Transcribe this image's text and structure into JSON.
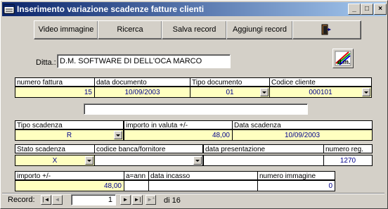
{
  "window": {
    "title": "Inserimento variazione scadenze fatture clienti",
    "minimize": "_",
    "maximize": "□",
    "close": "×"
  },
  "toolbar": {
    "video_label": "Video immagine",
    "search_label": "Ricerca",
    "save_label": "Salva record",
    "add_label": "Aggiungi record",
    "exit_icon": "door-exit-icon"
  },
  "ditta": {
    "label": "Ditta.:",
    "value": "D.M. SOFTWARE DI DELL'OCA MARCO"
  },
  "logo": {
    "text": "d.m."
  },
  "fields": {
    "numero_fattura": {
      "label": "numero fattura",
      "value": "15"
    },
    "data_documento": {
      "label": "data documento",
      "value": "10/09/2003"
    },
    "tipo_documento": {
      "label": "Tipo documento",
      "value": "01"
    },
    "codice_cliente": {
      "label": "Codice cliente",
      "value": "000101"
    },
    "tipo_scadenza": {
      "label": "Tipo scadenza",
      "value": "R"
    },
    "importo_valuta": {
      "label": "importo in valuta +/-",
      "value": "48,00"
    },
    "data_scadenza": {
      "label": "Data scadenza",
      "value": "10/09/2003"
    },
    "stato_scadenza": {
      "label": "Stato scadenza",
      "value": "X"
    },
    "codice_banca": {
      "label": "codice banca/fornitore",
      "value": ""
    },
    "data_presentazione": {
      "label": "data presentazione",
      "value": ""
    },
    "numero_reg": {
      "label": "numero reg.",
      "value": "1270"
    },
    "importo": {
      "label": "importo  +/-",
      "value": "48,00"
    },
    "ann": {
      "label": "a=ann",
      "value": ""
    },
    "data_incasso": {
      "label": "data incasso",
      "value": ""
    },
    "numero_immagine": {
      "label": "numero immagine",
      "value": "0"
    }
  },
  "nav": {
    "label": "Record:",
    "current": "1",
    "total_text": "di 16",
    "first": "|◄",
    "prev": "◄",
    "next": "►",
    "last": "►|",
    "new": "►*"
  }
}
